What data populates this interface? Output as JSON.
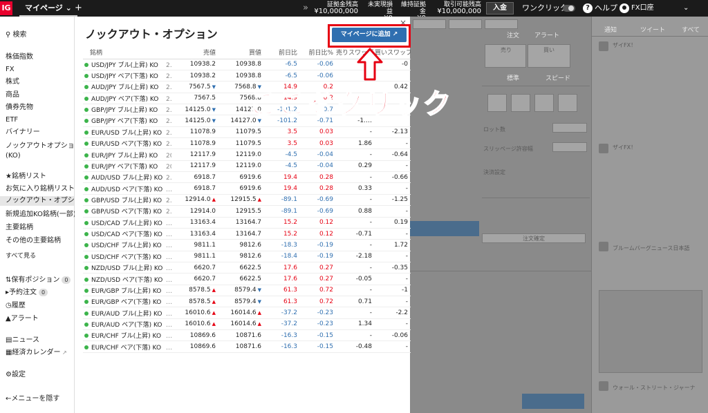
{
  "topbar": {
    "logo": "IG",
    "mypage": "マイページ ⌄",
    "plus": "+",
    "arrows": "»",
    "stats": [
      {
        "label": "証拠金残高",
        "value": "¥10,000,000"
      },
      {
        "label": "未実現損益",
        "value": "¥0"
      },
      {
        "label": "維持証拠金",
        "value": "¥0"
      },
      {
        "label": "取引可能残高",
        "value": "¥10,000,000"
      }
    ],
    "deposit": "入金",
    "oneclick": "ワンクリック",
    "help": "ヘルプ",
    "account": "FX口座",
    "chevron": "⌄"
  },
  "sidebar": {
    "search": "検索",
    "items": [
      "株価指数",
      "FX",
      "株式",
      "商品",
      "債券先物",
      "ETF",
      "バイナリー",
      "ノックアウトオプション",
      "(KO)"
    ],
    "lists": [
      "銘柄リスト",
      "お気に入り銘柄リスト",
      "ノックアウト・オプシ…",
      "新規追加KO銘柄(一部)",
      "主要銘柄",
      "その他の主要銘柄",
      "すべて見る"
    ],
    "positions": "保有ポジション",
    "positions_count": "0",
    "orders": "予約注文",
    "orders_count": "0",
    "history": "履歴",
    "alerts": "アラート",
    "news": "ニュース",
    "calendar": "経済カレンダー",
    "settings": "設定",
    "hide_menu": "メニューを隠す"
  },
  "panel": {
    "title": "ノックアウト・オプション",
    "close": "×",
    "add_button": "マイページに追加 ↗",
    "callout": "ここをクリック",
    "columns": [
      "銘柄",
      "売値",
      "買値",
      "前日比",
      "前日比%",
      "売りスワップ",
      "買いスワップ"
    ],
    "rows": [
      {
        "name": "USD/JPY ブル(上昇) KO",
        "code": "2…",
        "sell": "10938.2",
        "sa": "",
        "buy": "10938.8",
        "ba": "",
        "chg": "-6.5",
        "pct": "-0.06",
        "ss": "",
        "bs": "-0"
      },
      {
        "name": "USD/JPY ベア(下落) KO",
        "code": "2…",
        "sell": "10938.2",
        "sa": "",
        "buy": "10938.8",
        "ba": "",
        "chg": "-6.5",
        "pct": "-0.06",
        "ss": "",
        "bs": ""
      },
      {
        "name": "AUD/JPY ブル(上昇) KO",
        "code": "2…",
        "sell": "7567.5",
        "sa": "dn",
        "buy": "7568.8",
        "ba": "dn",
        "chg": "14.9",
        "pct": "0.2",
        "ss": "",
        "bs": "0.42"
      },
      {
        "name": "AUD/JPY ベア(下落) KO",
        "code": "2…",
        "sell": "7567.5",
        "sa": "",
        "buy": "7568.8",
        "ba": "",
        "chg": "14.9",
        "pct": "0.2",
        "ss": "",
        "bs": ""
      },
      {
        "name": "GBP/JPY ブル(上昇) KO",
        "code": "2…",
        "sell": "14125.0",
        "sa": "dn",
        "buy": "14127.0",
        "ba": "",
        "chg": "-101.2",
        "pct": "-0.7",
        "ss": "",
        "bs": ""
      },
      {
        "name": "GBP/JPY ベア(下落) KO",
        "code": "2…",
        "sell": "14125.0",
        "sa": "dn",
        "buy": "14127.0",
        "ba": "dn",
        "chg": "-101.2",
        "pct": "-0.71",
        "ss": "-1.…",
        "bs": ""
      },
      {
        "name": "EUR/USD ブル(上昇) KO",
        "code": "2…",
        "sell": "11078.9",
        "sa": "",
        "buy": "11079.5",
        "ba": "",
        "chg": "3.5",
        "pct": "0.03",
        "ss": "-",
        "bs": "-2.13"
      },
      {
        "name": "EUR/USD ベア(下落) KO",
        "code": "2…",
        "sell": "11078.9",
        "sa": "",
        "buy": "11079.5",
        "ba": "",
        "chg": "3.5",
        "pct": "0.03",
        "ss": "1.86",
        "bs": "-"
      },
      {
        "name": "EUR/JPY ブル(上昇) KO",
        "code": "20…",
        "sell": "12117.9",
        "sa": "",
        "buy": "12119.0",
        "ba": "",
        "chg": "-4.5",
        "pct": "-0.04",
        "ss": "-",
        "bs": "-0.64"
      },
      {
        "name": "EUR/JPY ベア(下落) KO",
        "code": "20…",
        "sell": "12117.9",
        "sa": "",
        "buy": "12119.0",
        "ba": "",
        "chg": "-4.5",
        "pct": "-0.04",
        "ss": "0.29",
        "bs": "-"
      },
      {
        "name": "AUD/USD ブル(上昇) KO",
        "code": "2…",
        "sell": "6918.7",
        "sa": "",
        "buy": "6919.6",
        "ba": "",
        "chg": "19.4",
        "pct": "0.28",
        "ss": "-",
        "bs": "-0.66"
      },
      {
        "name": "AUD/USD ベア(下落) KO",
        "code": "…",
        "sell": "6918.7",
        "sa": "",
        "buy": "6919.6",
        "ba": "",
        "chg": "19.4",
        "pct": "0.28",
        "ss": "0.33",
        "bs": "-"
      },
      {
        "name": "GBP/USD ブル(上昇) KO",
        "code": "2…",
        "sell": "12914.0",
        "sa": "up",
        "buy": "12915.5",
        "ba": "up",
        "chg": "-89.1",
        "pct": "-0.69",
        "ss": "-",
        "bs": "-1.25"
      },
      {
        "name": "GBP/USD ベア(下落) KO",
        "code": "2…",
        "sell": "12914.0",
        "sa": "",
        "buy": "12915.5",
        "ba": "",
        "chg": "-89.1",
        "pct": "-0.69",
        "ss": "0.88",
        "bs": "-"
      },
      {
        "name": "USD/CAD ブル(上昇) KO",
        "code": "…",
        "sell": "13163.4",
        "sa": "",
        "buy": "13164.7",
        "ba": "",
        "chg": "15.2",
        "pct": "0.12",
        "ss": "-",
        "bs": "0.19"
      },
      {
        "name": "USD/CAD ベア(下落) KO",
        "code": "…",
        "sell": "13163.4",
        "sa": "",
        "buy": "13164.7",
        "ba": "",
        "chg": "15.2",
        "pct": "0.12",
        "ss": "-0.71",
        "bs": "-"
      },
      {
        "name": "USD/CHF ブル(上昇) KO",
        "code": "…",
        "sell": "9811.1",
        "sa": "",
        "buy": "9812.6",
        "ba": "",
        "chg": "-18.3",
        "pct": "-0.19",
        "ss": "-",
        "bs": "1.72"
      },
      {
        "name": "USD/CHF ベア(下落) KO",
        "code": "…",
        "sell": "9811.1",
        "sa": "",
        "buy": "9812.6",
        "ba": "",
        "chg": "-18.4",
        "pct": "-0.19",
        "ss": "-2.18",
        "bs": "-"
      },
      {
        "name": "NZD/USD ブル(上昇) KO",
        "code": "…",
        "sell": "6620.7",
        "sa": "",
        "buy": "6622.5",
        "ba": "",
        "chg": "17.6",
        "pct": "0.27",
        "ss": "-",
        "bs": "-0.35"
      },
      {
        "name": "NZD/USD ベア(下落) KO",
        "code": "…",
        "sell": "6620.7",
        "sa": "",
        "buy": "6622.5",
        "ba": "",
        "chg": "17.6",
        "pct": "0.27",
        "ss": "-0.05",
        "bs": "-"
      },
      {
        "name": "EUR/GBP ブル(上昇) KO",
        "code": "…",
        "sell": "8578.5",
        "sa": "up",
        "buy": "8579.4",
        "ba": "dn",
        "chg": "61.3",
        "pct": "0.72",
        "ss": "-",
        "bs": "-1"
      },
      {
        "name": "EUR/GBP ベア(下落) KO",
        "code": "…",
        "sell": "8578.5",
        "sa": "up",
        "buy": "8579.4",
        "ba": "dn",
        "chg": "61.3",
        "pct": "0.72",
        "ss": "0.71",
        "bs": "-"
      },
      {
        "name": "EUR/AUD ブル(上昇) KO",
        "code": "…",
        "sell": "16010.6",
        "sa": "up",
        "buy": "16014.6",
        "ba": "up",
        "chg": "-37.2",
        "pct": "-0.23",
        "ss": "-",
        "bs": "-2.2"
      },
      {
        "name": "EUR/AUD ベア(下落) KO",
        "code": "…",
        "sell": "16010.6",
        "sa": "up",
        "buy": "16014.6",
        "ba": "up",
        "chg": "-37.2",
        "pct": "-0.23",
        "ss": "1.34",
        "bs": "-"
      },
      {
        "name": "EUR/CHF ブル(上昇) KO",
        "code": "…",
        "sell": "10869.6",
        "sa": "",
        "buy": "10871.6",
        "ba": "",
        "chg": "-16.3",
        "pct": "-0.15",
        "ss": "-",
        "bs": "-0.06"
      },
      {
        "name": "EUR/CHF ベア(下落) KO",
        "code": "…",
        "sell": "10869.6",
        "sa": "",
        "buy": "10871.6",
        "ba": "",
        "chg": "-16.3",
        "pct": "-0.15",
        "ss": "-0.48",
        "bs": "-"
      }
    ]
  },
  "bg": {
    "tabs": [
      "注文",
      "アラート"
    ],
    "news_tabs": [
      "通知",
      "ツイート",
      "すべて"
    ],
    "sell_label": "売り",
    "buy_label": "買い",
    "mode_tabs": [
      "標準",
      "スピード"
    ],
    "lot": "ロット数",
    "slippage": "スリッページ許容幅",
    "stop": "決済設定",
    "confirm": "注文確定",
    "feeds": [
      "ザイFX！",
      "ザイFX！",
      "ブルームバーグニュース日本語",
      "ウォール・ストリート・ジャーナ"
    ]
  },
  "colors": {
    "accent": "#2f6fb0",
    "callout": "#e60012",
    "up": "#e60012",
    "down": "#2f6fb0",
    "status": "#3cb44b"
  }
}
